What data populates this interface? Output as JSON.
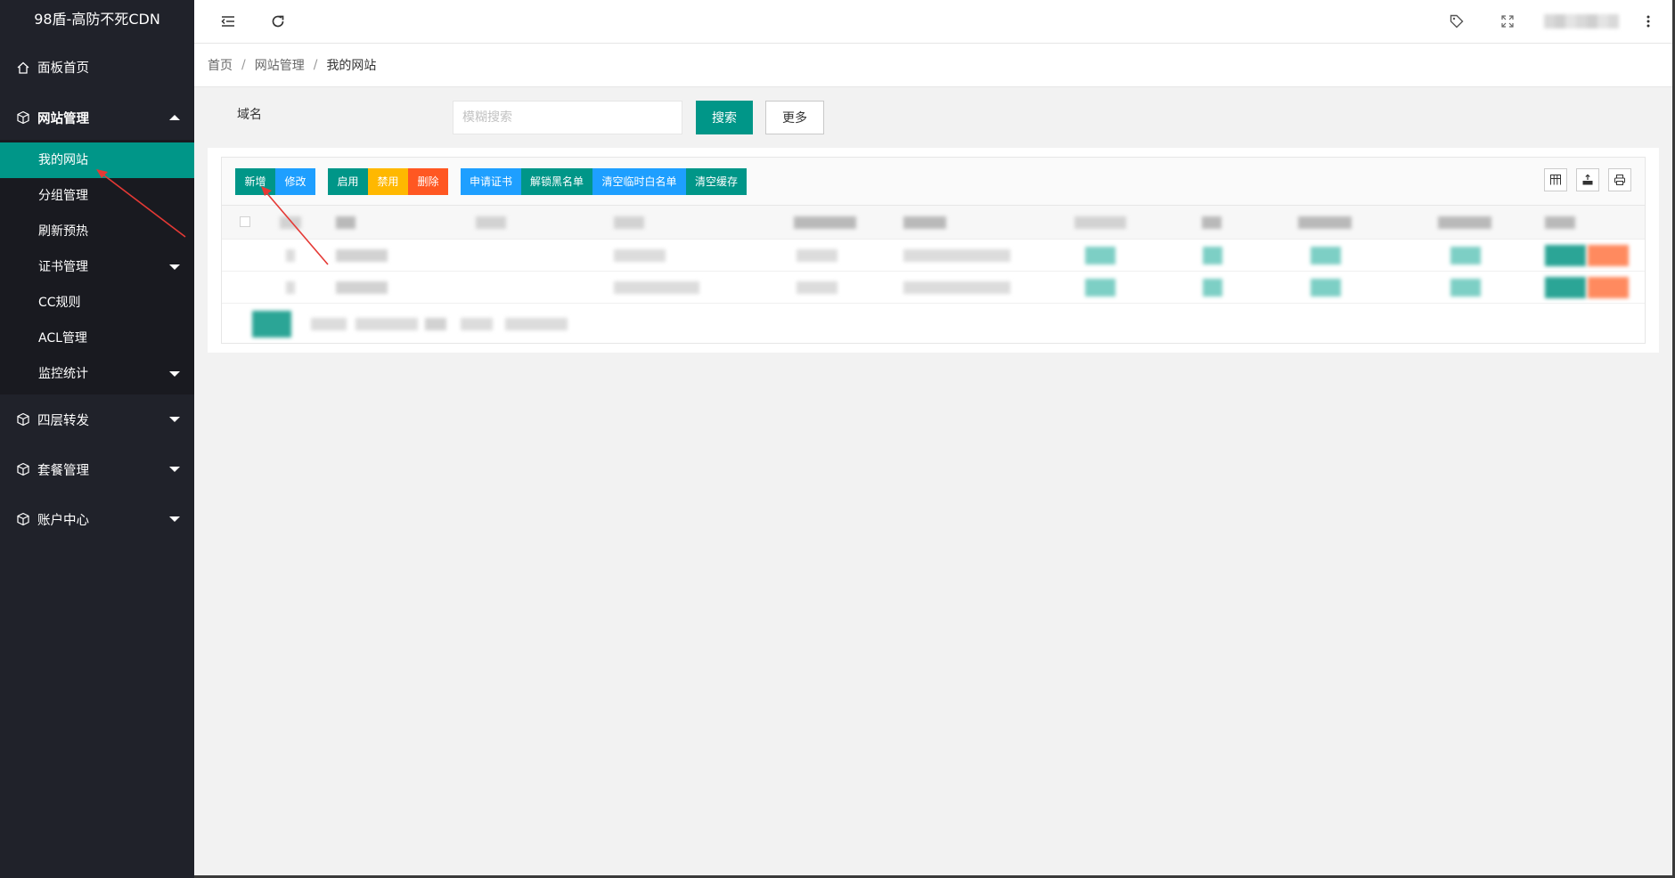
{
  "app": {
    "title": "98盾-高防不死CDN"
  },
  "sidebar": {
    "groups": [
      {
        "label": "面板首页",
        "icon": "home-icon",
        "expanded": false
      },
      {
        "label": "网站管理",
        "icon": "cube-icon",
        "expanded": true
      },
      {
        "label": "四层转发",
        "icon": "cube-icon",
        "expanded": false
      },
      {
        "label": "套餐管理",
        "icon": "cube-icon",
        "expanded": false
      },
      {
        "label": "账户中心",
        "icon": "cube-icon",
        "expanded": false
      }
    ],
    "site_items": [
      {
        "label": "我的网站",
        "active": true
      },
      {
        "label": "分组管理"
      },
      {
        "label": "刷新预热"
      },
      {
        "label": "证书管理",
        "has_children": true
      },
      {
        "label": "CC规则"
      },
      {
        "label": "ACL管理"
      },
      {
        "label": "监控统计",
        "has_children": true
      }
    ]
  },
  "header": {
    "icons": [
      "menu-fold-icon",
      "refresh-icon",
      "tag-icon",
      "fullscreen-icon",
      "more-vertical-icon"
    ]
  },
  "breadcrumb": {
    "items": [
      "首页",
      "网站管理",
      "我的网站"
    ],
    "separator": "/"
  },
  "search": {
    "label": "域名",
    "placeholder": "模糊搜索",
    "search_button": "搜索",
    "more_button": "更多"
  },
  "toolbar": {
    "buttons": [
      {
        "label": "新增",
        "color": "#009688"
      },
      {
        "label": "修改",
        "color": "#1e9fff"
      },
      {
        "label": "启用",
        "color": "#009688"
      },
      {
        "label": "禁用",
        "color": "#ffb800"
      },
      {
        "label": "删除",
        "color": "#ff5722"
      },
      {
        "label": "申请证书",
        "color": "#1e9fff"
      },
      {
        "label": "解锁黑名单",
        "color": "#009688"
      },
      {
        "label": "清空临时白名单",
        "color": "#1e9fff"
      },
      {
        "label": "清空缓存",
        "color": "#009688"
      }
    ],
    "tools": [
      "columns-icon",
      "export-icon",
      "print-icon"
    ]
  },
  "colors": {
    "accent": "#009688",
    "blue": "#1e9fff",
    "warn": "#ffb800",
    "danger": "#ff5722",
    "sidebar": "#20222a"
  }
}
